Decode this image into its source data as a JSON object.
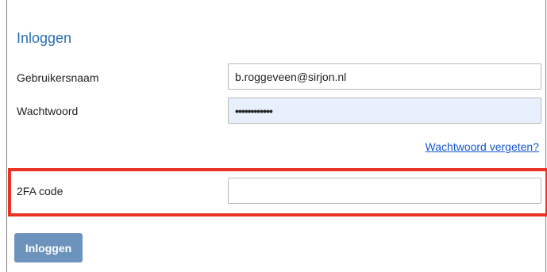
{
  "form": {
    "title": "Inloggen",
    "username": {
      "label": "Gebruikersnaam",
      "value": "b.roggeveen@sirjon.nl"
    },
    "password": {
      "label": "Wachtwoord",
      "masked_value": "••••••••••••"
    },
    "forgot_link": "Wachtwoord vergeten?",
    "twofa": {
      "label": "2FA code",
      "value": ""
    },
    "submit_label": "Inloggen"
  },
  "colors": {
    "title": "#2a6fb0",
    "link": "#1558d6",
    "highlight": "#ea3323",
    "button": "#6c93bc",
    "autofill": "#e8f0fe"
  }
}
